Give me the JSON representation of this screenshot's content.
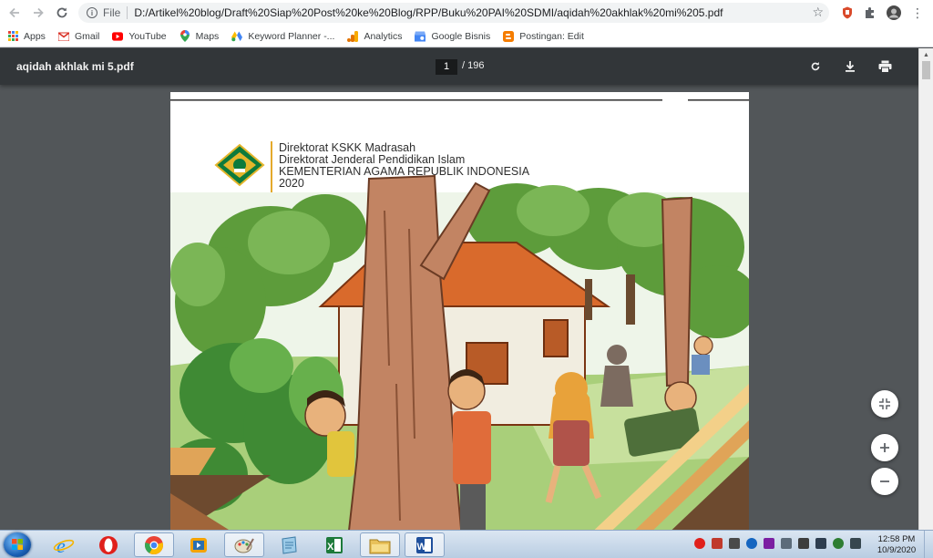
{
  "browser": {
    "address": {
      "scheme_label": "File",
      "url": "D:/Artikel%20blog/Draft%20Siap%20Post%20ke%20Blog/RPP/Buku%20PAI%20SDMI/aqidah%20akhlak%20mi%205.pdf"
    },
    "bookmarks": [
      {
        "label": "Apps",
        "icon": "apps-grid-icon",
        "color": "#ea4335"
      },
      {
        "label": "Gmail",
        "icon": "gmail-icon",
        "color": "#d93025"
      },
      {
        "label": "YouTube",
        "icon": "youtube-icon",
        "color": "#ff0000"
      },
      {
        "label": "Maps",
        "icon": "maps-icon",
        "color": "#34a853"
      },
      {
        "label": "Keyword Planner -...",
        "icon": "google-ads-icon",
        "color": "#4285f4"
      },
      {
        "label": "Analytics",
        "icon": "analytics-icon",
        "color": "#f9ab00"
      },
      {
        "label": "Google Bisnis",
        "icon": "google-business-icon",
        "color": "#4285f4"
      },
      {
        "label": "Postingan: Edit",
        "icon": "blogger-icon",
        "color": "#f57d00"
      }
    ]
  },
  "pdf": {
    "filename": "aqidah akhlak mi 5.pdf",
    "current_page": "1",
    "total_pages": "/ 196"
  },
  "cover": {
    "line1": "Direktorat KSKK Madrasah",
    "line2": "Direktorat Jenderal Pendidikan Islam",
    "line3": "KEMENTERIAN AGAMA REPUBLIK INDONESIA",
    "line4": "2020"
  },
  "taskbar": {
    "apps": [
      {
        "name": "internet-explorer-icon",
        "color": "#1e88e5"
      },
      {
        "name": "opera-icon",
        "color": "#e0201b"
      },
      {
        "name": "chrome-icon",
        "color": "#34a853"
      },
      {
        "name": "media-player-icon",
        "color": "#f4a300"
      },
      {
        "name": "paint-icon",
        "color": "#5aa0d8"
      },
      {
        "name": "notepad-icon",
        "color": "#7fb1d6"
      },
      {
        "name": "excel-icon",
        "color": "#1d7a3a"
      },
      {
        "name": "file-explorer-icon",
        "color": "#e8c15a"
      },
      {
        "name": "word-icon",
        "color": "#1e4f9c"
      }
    ],
    "time": "12:58 PM",
    "date": "10/9/2020"
  }
}
